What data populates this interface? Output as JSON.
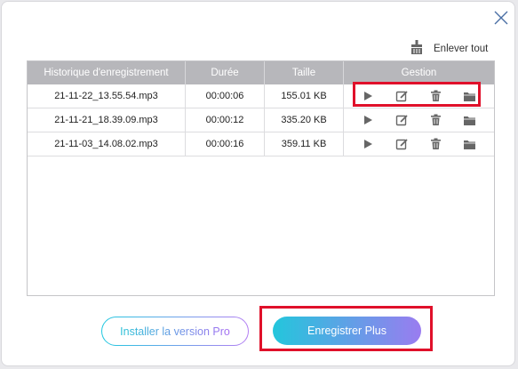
{
  "dialog": {
    "close_icon": "close-icon",
    "clear_all": {
      "icon": "broom-icon",
      "label": "Enlever tout"
    }
  },
  "table": {
    "headers": [
      "Historique d'enregistrement",
      "Durée",
      "Taille",
      "Gestion"
    ],
    "rows": [
      {
        "file": "21-11-22_13.55.54.mp3",
        "duration": "00:00:06",
        "size": "155.01 KB"
      },
      {
        "file": "21-11-21_18.39.09.mp3",
        "duration": "00:00:12",
        "size": "335.20 KB"
      },
      {
        "file": "21-11-03_14.08.02.mp3",
        "duration": "00:00:16",
        "size": "359.11 KB"
      }
    ],
    "action_icons": [
      "play-icon",
      "edit-icon",
      "trash-icon",
      "folder-icon"
    ]
  },
  "footer": {
    "install_pro_label": "Installer la version Pro",
    "record_more_label": "Enregistrer Plus"
  },
  "colors": {
    "header_bg": "#b7b7bb",
    "highlight": "#e0102a",
    "gradient_start": "#23c6dc",
    "gradient_end": "#9a7cf0",
    "icon": "#666666"
  }
}
